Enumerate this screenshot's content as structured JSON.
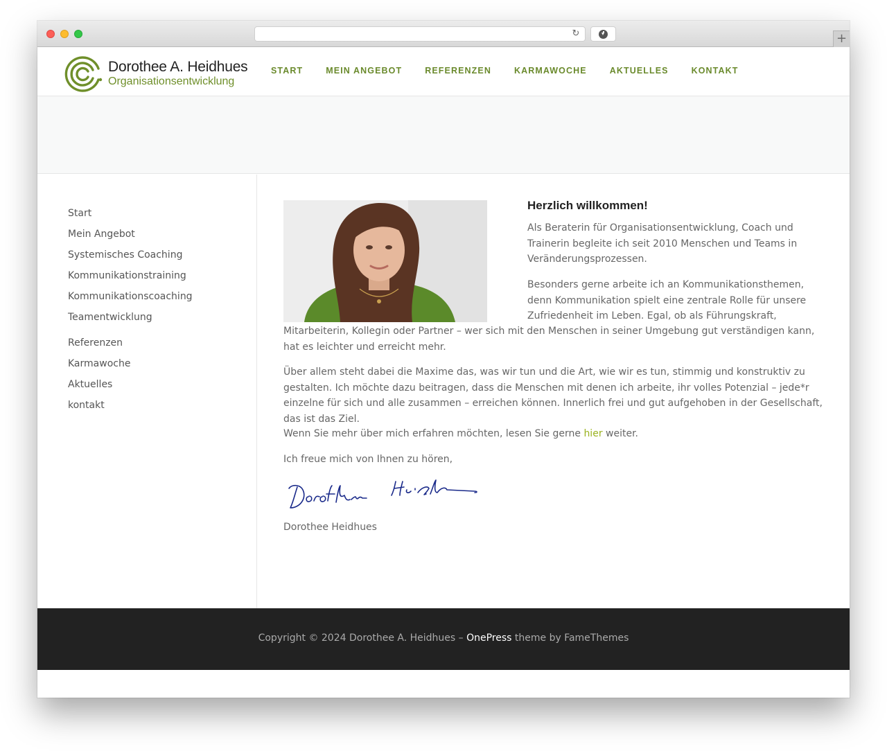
{
  "browser": {
    "url": "",
    "icons": [
      "reload-icon",
      "download-icon",
      "plus-icon"
    ]
  },
  "header": {
    "logo_title": "Dorothee A. Heidhues",
    "logo_subtitle": "Organisationsentwicklung",
    "nav": [
      "START",
      "MEIN ANGEBOT",
      "REFERENZEN",
      "KARMAWOCHE",
      "AKTUELLES",
      "KONTAKT"
    ]
  },
  "sidebar": {
    "items": [
      "Start",
      "Mein Angebot",
      "Systemisches Coaching",
      "Kommunikationstraining",
      "Kommunikationscoaching",
      "Teamentwicklung",
      "Referenzen",
      "Karmawoche",
      "Aktuelles",
      "kontakt"
    ]
  },
  "content": {
    "title": "Herzlich willkommen!",
    "intro": "Als Beraterin für Organisationsentwicklung, Coach und Trainerin begleite ich seit 2010 Menschen und Teams in Veränderungsprozessen.",
    "para2_top": "Besonders gerne arbeite ich an Kommunikationsthemen, denn Kommunikation spielt eine zentrale Rolle für unsere Zufriedenheit im Leben. Egal, ob als Führungskraft,",
    "para2_bottom": "Mitarbeiterin, Kollegin oder Partner – wer sich mit den Menschen in seiner Umgebung gut verständigen kann, hat es leichter und erreicht mehr.",
    "para3": "Über allem steht dabei die Maxime das, was wir tun und die Art, wie wir es tun, stimmig und konstruktiv zu gestalten. Ich möchte dazu beitragen, dass die Menschen mit denen ich arbeite, ihr volles Potenzial – jede*r einzelne für sich und alle zusammen – erreichen können. Innerlich frei und gut aufgehoben in der Gesellschaft, das ist das Ziel.",
    "para4_before": "Wenn Sie mehr über mich erfahren möchten, lesen Sie gerne ",
    "para4_link": "hier",
    "para4_after": " weiter.",
    "para5": "Ich freue mich von Ihnen zu hören,",
    "signature_text": "Dorothee Heidhues",
    "signer": "Dorothee Heidhues"
  },
  "footer": {
    "prefix": "Copyright © 2024 Dorothee A. Heidhues – ",
    "theme_link": "OnePress",
    "suffix": " theme by FameThemes"
  },
  "colors": {
    "accent_green": "#6a8a2c",
    "link_green": "#9ab21f",
    "footer_bg": "#222222"
  }
}
